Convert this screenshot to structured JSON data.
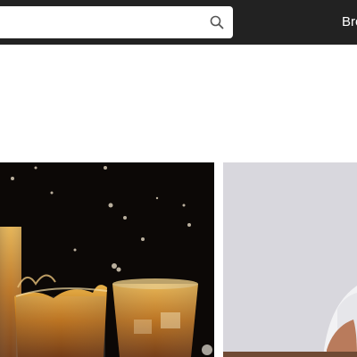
{
  "header": {
    "search": {
      "value": "",
      "placeholder": "",
      "icon": "search-icon"
    },
    "nav": {
      "browse_label": "Bro"
    }
  },
  "gallery": {
    "photos": [
      {
        "subject": "whiskey-glasses-splash"
      },
      {
        "subject": "person-portrait"
      }
    ]
  }
}
